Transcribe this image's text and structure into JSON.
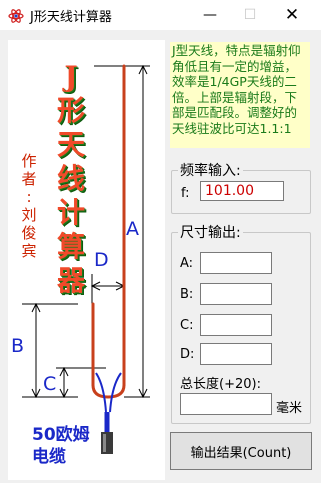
{
  "window": {
    "title": "J形天线计算器",
    "minimize_glyph": "—",
    "maximize_glyph": "☐",
    "close_glyph": "✕",
    "icon": "atom-icon"
  },
  "diagram": {
    "title_chars": [
      "J",
      "形",
      "天",
      "线",
      "计",
      "算",
      "器"
    ],
    "author_chars": [
      "作",
      "者",
      ":",
      "刘",
      "俊",
      "宾"
    ],
    "label_a": "A",
    "label_b": "B",
    "label_c": "C",
    "label_d": "D",
    "cable_line1": "50欧姆",
    "cable_line2": "电缆",
    "colors": {
      "element": "#c8401c",
      "dimension": "#000000",
      "cable": "#1a28c8"
    }
  },
  "info": {
    "text": "J型天线，特点是辐射仰角低且有一定的增益，效率是1/4GP天线的二倍。上部是辐射段，下部是匹配段。调整好的天线驻波比可达1.1:1"
  },
  "frequency": {
    "group_title": "频率输入:",
    "label": "f:",
    "value": "101.00"
  },
  "dimensions": {
    "group_title": "尺寸输出:",
    "fields": [
      {
        "label": "A:",
        "value": ""
      },
      {
        "label": "B:",
        "value": ""
      },
      {
        "label": "C:",
        "value": ""
      },
      {
        "label": "D:",
        "value": ""
      }
    ],
    "total_label": "总长度(+20):",
    "total_value": "",
    "unit": "毫米"
  },
  "button": {
    "label": "输出结果(Count)"
  }
}
